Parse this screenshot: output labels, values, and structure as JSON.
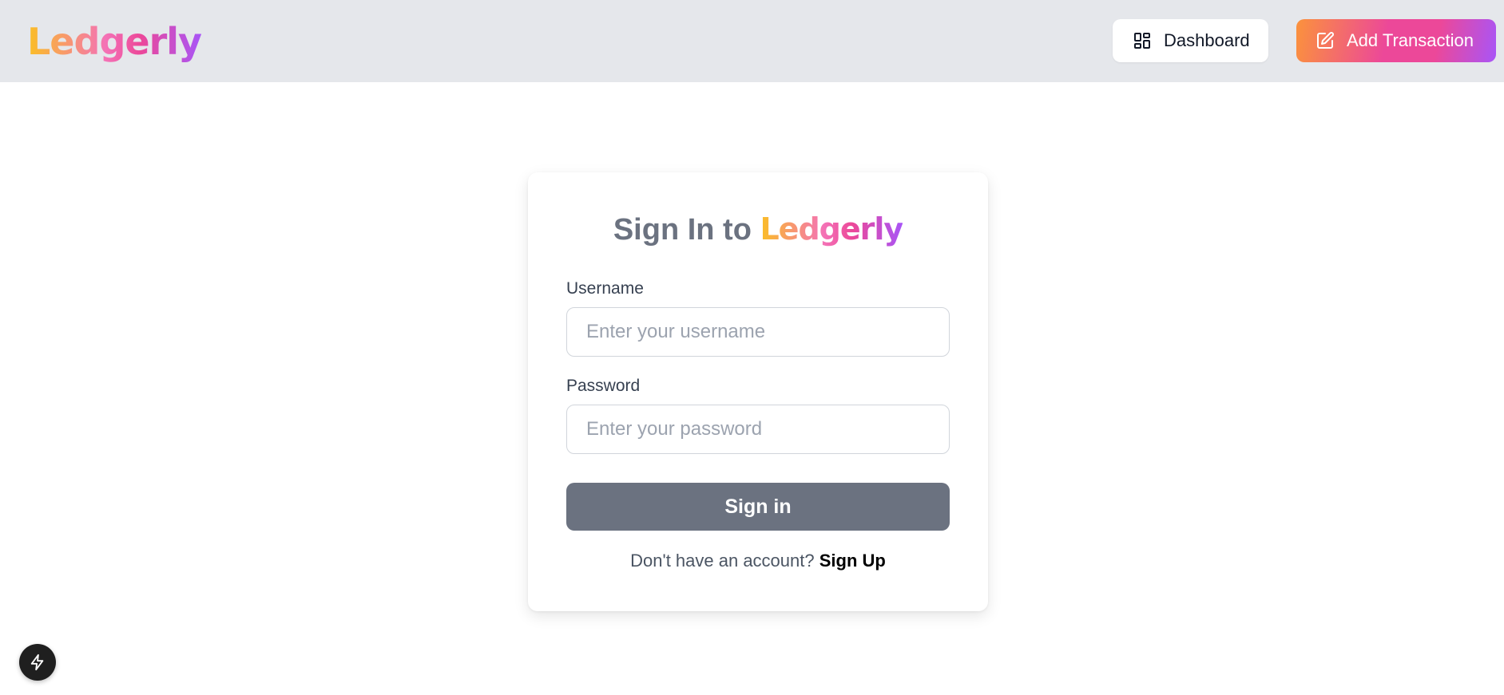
{
  "header": {
    "brand": "Ledgerly",
    "dashboard_label": "Dashboard",
    "add_transaction_label": "Add Transaction"
  },
  "login": {
    "title_prefix": "Sign In to",
    "title_brand": "Ledgerly",
    "username_label": "Username",
    "username_placeholder": "Enter your username",
    "username_value": "",
    "password_label": "Password",
    "password_placeholder": "Enter your password",
    "password_value": "",
    "submit_label": "Sign in",
    "signup_prompt": "Don't have an account?",
    "signup_link": "Sign Up"
  },
  "icons": {
    "dashboard": "grid-icon",
    "add_transaction": "edit-icon",
    "dev_tools": "bolt-icon"
  },
  "colors": {
    "header_bg": "#e5e7eb",
    "submit_bg": "#6b7280",
    "brand_gradient_start": "#fbbf24",
    "brand_gradient_mid": "#ec4899",
    "brand_gradient_end": "#a855f7"
  }
}
